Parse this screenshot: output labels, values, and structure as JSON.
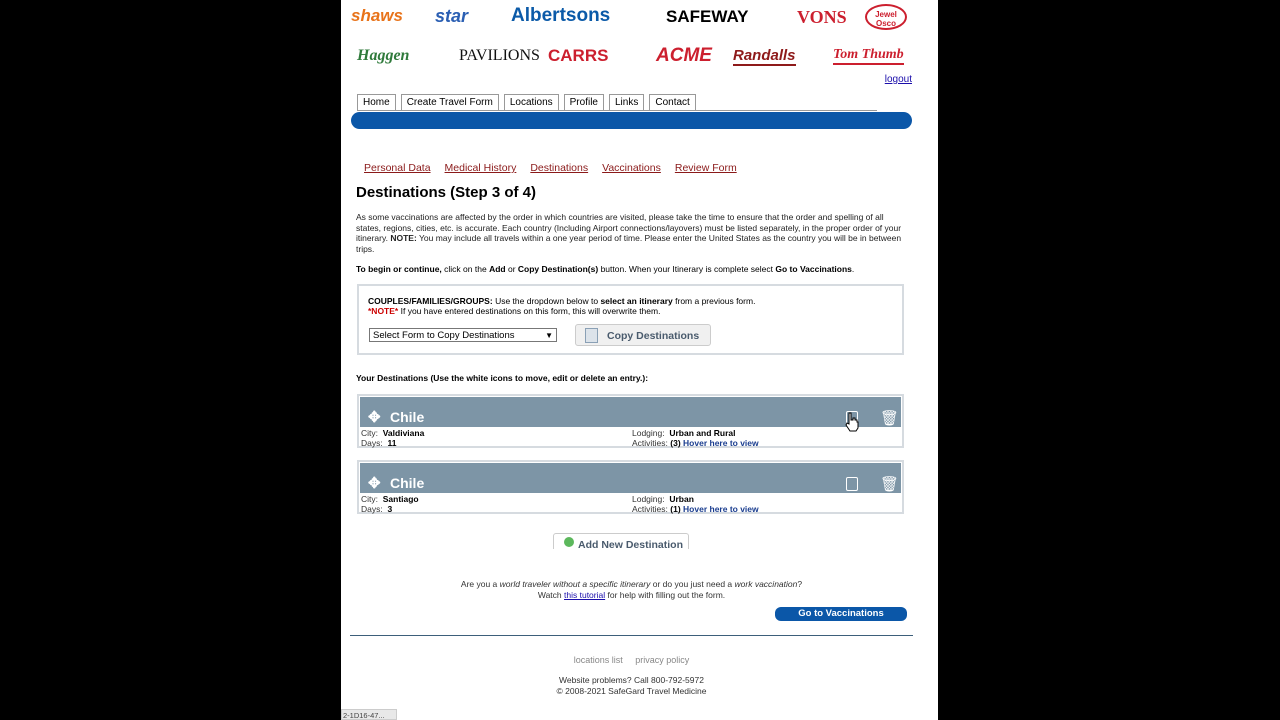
{
  "brands": [
    {
      "name": "shaws",
      "color": "#e8731a"
    },
    {
      "name": "star",
      "color": "#2b5fb3"
    },
    {
      "name": "Albertsons",
      "color": "#0b5aa8"
    },
    {
      "name": "SAFEWAY",
      "color": "#000000"
    },
    {
      "name": "VONS",
      "color": "#cc1f2e"
    },
    {
      "name": "Jewel Osco",
      "color": "#cc1f2e"
    },
    {
      "name": "Haggen",
      "color": "#2f7a3b"
    },
    {
      "name": "PAVILIONS",
      "color": "#111111"
    },
    {
      "name": "CARRS",
      "color": "#cc1f2e"
    },
    {
      "name": "ACME",
      "color": "#cc1f2e"
    },
    {
      "name": "Randalls",
      "color": "#8e1a1a"
    },
    {
      "name": "Tom Thumb",
      "color": "#cc1f2e"
    }
  ],
  "header": {
    "logout": "logout"
  },
  "nav": {
    "tabs": [
      {
        "label": "Home"
      },
      {
        "label": "Create Travel Form"
      },
      {
        "label": "Locations"
      },
      {
        "label": "Profile"
      },
      {
        "label": "Links"
      },
      {
        "label": "Contact"
      }
    ]
  },
  "steps": {
    "items": [
      "Personal Data",
      "Medical History",
      "Destinations",
      "Vaccinations",
      "Review Form"
    ]
  },
  "page": {
    "title": "Destinations (Step 3 of 4)",
    "intro": "As some vaccinations are affected by the order in which countries are visited, please take the time to ensure that the order and spelling of all states, regions, cities, etc. is accurate. Each country (Including Airport connections/layovers) must be listed separately, in the proper order of your itinerary.",
    "intro_note_label": "NOTE:",
    "intro_note": "You may include all travels within a one year period of time. Please enter the United States as the country you will be in between trips.",
    "instruction_bold1": "To begin or continue,",
    "instruction_mid": "click on the",
    "instruction_add": "Add",
    "instruction_or": "or",
    "instruction_copy": "Copy Destination(s)",
    "instruction_when": "button. When your Itinerary is complete select",
    "instruction_go": "Go to Vaccinations",
    "instruction_end": "."
  },
  "groups": {
    "label": "COUPLES/FAMILIES/GROUPS:",
    "text1": "Use the dropdown below to",
    "text_bold": "select an itinerary",
    "text2": "from a previous form.",
    "note_label": "*NOTE*",
    "note": "If you have entered destinations on this form, this will overwrite them.",
    "select_value": "Select Form to Copy Destinations",
    "copy_button": "Copy Destinations"
  },
  "your_destinations_label": "Your Destinations (Use the white icons to move, edit or delete an entry.):",
  "destinations": [
    {
      "country": "Chile",
      "city_label": "City:",
      "city": "Valdiviana",
      "days_label": "Days:",
      "days": "11",
      "lodging_label": "Lodging:",
      "lodging": "Urban and Rural",
      "activities_label": "Activities:",
      "activities_count": "(3)",
      "hover": "Hover here to view"
    },
    {
      "country": "Chile",
      "city_label": "City:",
      "city": "Santiago",
      "days_label": "Days:",
      "days": "3",
      "lodging_label": "Lodging:",
      "lodging": "Urban",
      "activities_label": "Activities:",
      "activities_count": "(1)",
      "hover": "Hover here to view"
    }
  ],
  "add_button": "Add New Destination",
  "traveler": {
    "t1": "Are you a",
    "t2": "world traveler without a specific itinerary",
    "t3": "or do you just need a",
    "t4": "work vaccination",
    "t5": "?",
    "watch": "Watch",
    "tutorial": "this tutorial",
    "help": "for help with filling out the form."
  },
  "go_vaccinations": "Go to Vaccinations",
  "footer": {
    "links": [
      "locations list",
      "privacy policy"
    ],
    "problems": "Website problems? Call 800-792-5972",
    "copyright": "© 2008-2021 SafeGard Travel Medicine"
  },
  "statusbar": "2-1D16-47..."
}
